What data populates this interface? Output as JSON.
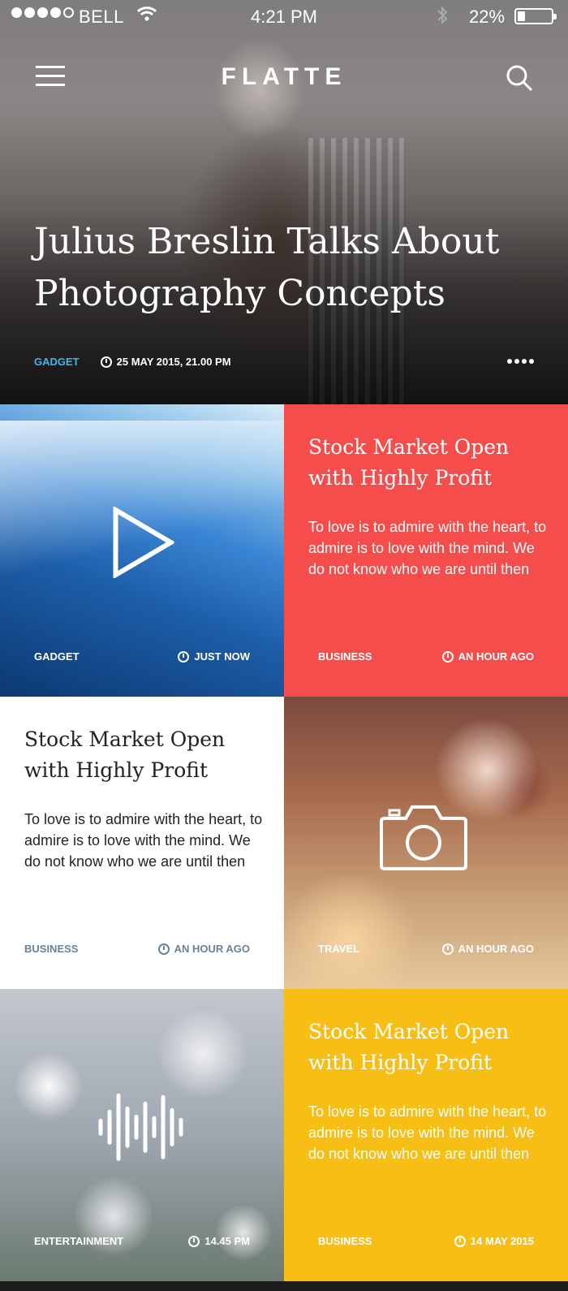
{
  "status_bar": {
    "carrier": "BELL",
    "time": "4:21 PM",
    "battery": "22%",
    "battery_level": 0.22
  },
  "header": {
    "brand": "FLATTE",
    "menu_icon": "hamburger-menu-icon",
    "search_icon": "search-icon"
  },
  "hero": {
    "title": "Julius Breslin Talks About Photography Concepts",
    "category": "GADGET",
    "date": "25 MAY 2015, 21.00 PM",
    "category_color": "#3fb5f0"
  },
  "tiles": [
    {
      "type": "video",
      "icon": "play-icon",
      "category": "GADGET",
      "time": "JUST NOW"
    },
    {
      "type": "article",
      "title": "Stock Market Open with Highly Profit",
      "excerpt": "To love is to admire with the heart, to admire is to love with the mind. We do not know who we are until then",
      "category": "BUSINESS",
      "time": "AN HOUR AGO",
      "color": "#f54c4c"
    },
    {
      "type": "article",
      "title": "Stock Market Open with Highly Profit",
      "excerpt": "To love is to admire with the heart, to admire is to love with the mind. We do not know who we are until then",
      "category": "BUSINESS",
      "time": "AN HOUR AGO",
      "color": "#ffffff"
    },
    {
      "type": "photo",
      "icon": "camera-icon",
      "category": "TRAVEL",
      "time": "AN HOUR AGO"
    },
    {
      "type": "audio",
      "icon": "audio-wave-icon",
      "category": "ENTERTAINMENT",
      "time": "14.45 PM"
    },
    {
      "type": "article",
      "title": "Stock Market Open with Highly Profit",
      "excerpt": "To love is to admire with the heart, to admire is to love with the mind. We do not know who we are until then",
      "category": "BUSINESS",
      "time": "14 MAY 2015",
      "color": "#f7be16"
    }
  ]
}
